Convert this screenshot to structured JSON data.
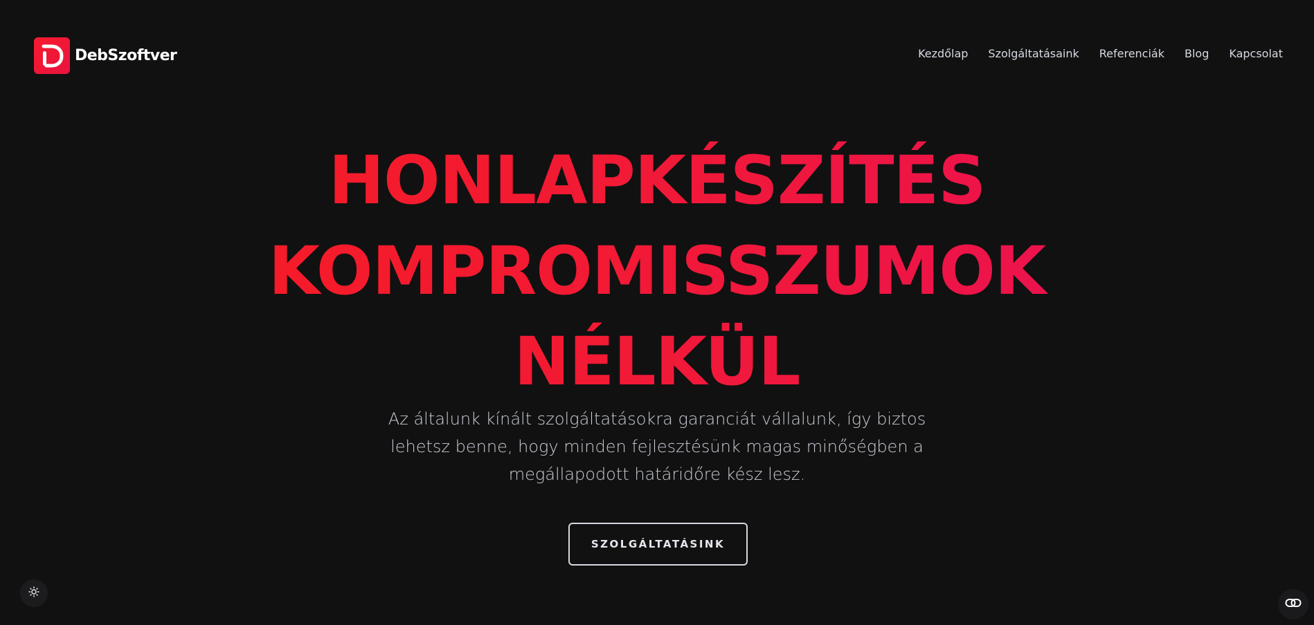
{
  "brand": {
    "name": "DebSzoftver",
    "logo_icon": "d-letter-logo-icon",
    "accent_color": "#f0173a"
  },
  "nav": {
    "items": [
      {
        "label": "Kezdőlap"
      },
      {
        "label": "Szolgáltatásaink"
      },
      {
        "label": "Referenciák"
      },
      {
        "label": "Blog"
      },
      {
        "label": "Kapcsolat"
      }
    ]
  },
  "hero": {
    "title_lines": [
      "HONLAPKÉSZÍTÉS",
      "KOMPROMISSZUMOK",
      "NÉLKÜL"
    ],
    "subtitle": "Az általunk kínált szolgáltatásokra garanciát vállalunk, így biztos lehetsz benne, hogy minden fejlesztésünk magas minőségben a megállapodott határidőre kész lesz.",
    "cta_label": "SZOLGÁLTATÁSINK"
  },
  "widgets": {
    "theme_toggle_icon": "sun-icon",
    "link_widget_icon": "link-icon"
  },
  "colors": {
    "background": "#111111",
    "title_gradient_start": "#f81c1f",
    "title_gradient_end": "#e60e62",
    "nav_text": "#d6dae2",
    "body_text": "#c9cdd6"
  }
}
